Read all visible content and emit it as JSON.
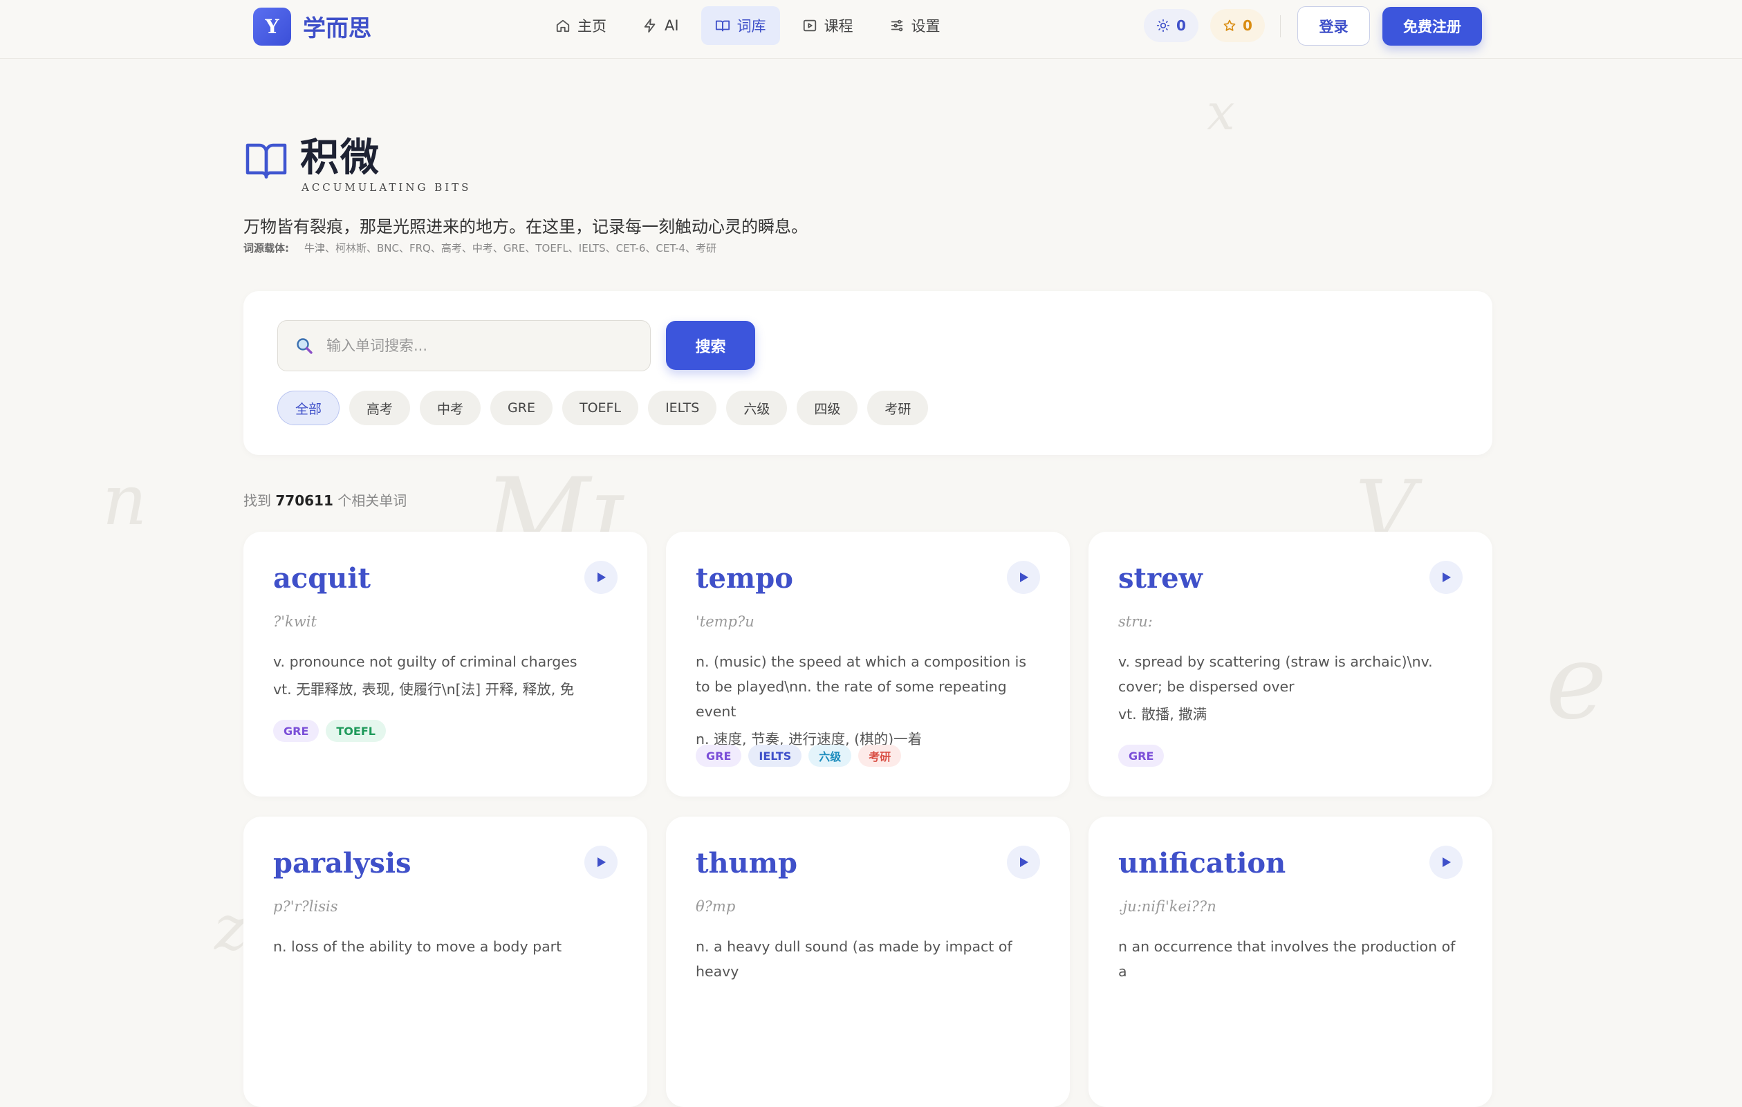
{
  "header": {
    "logo_letter": "Y",
    "logo_text": "学而思",
    "nav": [
      {
        "label": "主页",
        "icon": "home-icon"
      },
      {
        "label": "AI",
        "icon": "bolt-icon"
      },
      {
        "label": "词库",
        "icon": "book-icon"
      },
      {
        "label": "课程",
        "icon": "video-icon"
      },
      {
        "label": "设置",
        "icon": "sliders-icon"
      }
    ],
    "active_nav": "词库",
    "sun_count": "0",
    "star_count": "0",
    "login_label": "登录",
    "register_label": "免费注册"
  },
  "hero": {
    "title": "积微",
    "subtitle": "ACCUMULATING BITS",
    "tagline": "万物皆有裂痕，那是光照进来的地方。在这里，记录每一刻触动心灵的瞬息。",
    "sources_label": "词源载体:",
    "sources": "牛津、柯林斯、BNC、FRQ、高考、中考、GRE、TOEFL、IELTS、CET-6、CET-4、考研"
  },
  "search": {
    "placeholder": "输入单词搜索...",
    "button_label": "搜索",
    "filters": [
      "全部",
      "高考",
      "中考",
      "GRE",
      "TOEFL",
      "IELTS",
      "六级",
      "四级",
      "考研"
    ],
    "active_filter": "全部"
  },
  "results": {
    "prefix": "找到",
    "count": "770611",
    "suffix": "个相关单词"
  },
  "colors": {
    "accent": "#3c55dc",
    "background": "#f8f7f4"
  },
  "words": [
    {
      "word": "acquit",
      "phonetic": "?'kwit",
      "def_en": "v. pronounce not guilty of criminal charges",
      "def_cn": "vt. 无罪释放, 表现, 使履行\\n[法] 开释, 释放, 免",
      "tags": [
        "GRE",
        "TOEFL"
      ]
    },
    {
      "word": "tempo",
      "phonetic": "'temp?u",
      "def_en": "n. (music) the speed at which a composition is to be played\\nn. the rate of some repeating event",
      "def_cn": "n. 速度, 节奏, 进行速度, (棋的)一着",
      "tags": [
        "GRE",
        "IELTS",
        "六级",
        "考研"
      ]
    },
    {
      "word": "strew",
      "phonetic": "stru:",
      "def_en": "v. spread by scattering (straw is archaic)\\nv. cover; be dispersed over",
      "def_cn": "vt. 散播, 撒满",
      "tags": [
        "GRE"
      ]
    },
    {
      "word": "paralysis",
      "phonetic": "p?'r?lisis",
      "def_en": "n. loss of the ability to move a body part",
      "def_cn": "",
      "tags": []
    },
    {
      "word": "thump",
      "phonetic": "θ?mp",
      "def_en": "n. a heavy dull sound (as made by impact of heavy",
      "def_cn": "",
      "tags": []
    },
    {
      "word": "unification",
      "phonetic": ".ju:nifi'kei??n",
      "def_en": "n an occurrence that involves the production of a",
      "def_cn": "",
      "tags": []
    }
  ]
}
